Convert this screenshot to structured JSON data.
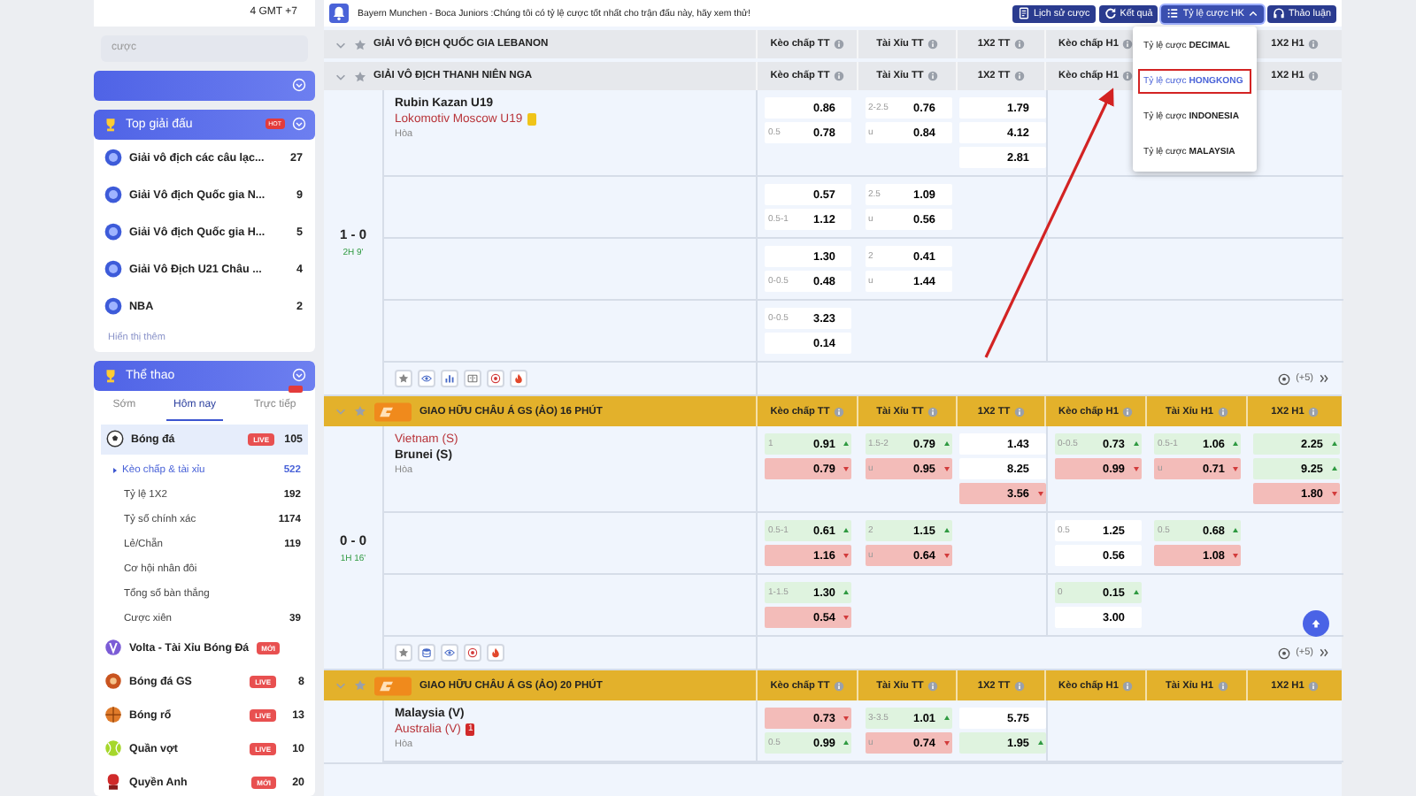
{
  "header": {
    "timezone": "4 GMT +7",
    "search": {
      "placeholder": "cược"
    }
  },
  "notice": {
    "text": "Bayern Munchen - Boca Juniors :Chúng tôi có tỷ lệ cược tốt nhất cho trận đấu này, hãy xem thử!"
  },
  "toolbar": {
    "history": {
      "label": "Lịch sử cược"
    },
    "results": {
      "label": "Kết quả"
    },
    "odds_format": {
      "label": "Tỷ lệ cược HK",
      "expanded": true,
      "items": [
        {
          "label": "Tỷ lệ cược **DECIMAL**",
          "selected": false
        },
        {
          "label": "Tỷ lệ cược **HONGKONG**",
          "selected": true
        },
        {
          "label": "Tỷ lệ cược **INDONESIA**",
          "selected": false
        },
        {
          "label": "Tỷ lệ cược **MALAYSIA**",
          "selected": false
        }
      ]
    },
    "discussion": {
      "label": "Thảo luận"
    }
  },
  "top_leagues": {
    "title": "Top giải đấu",
    "badge": "HOT",
    "items": [
      {
        "name": "Giải vô địch các câu lạc...",
        "count": "27"
      },
      {
        "name": "Giải Vô địch Quốc gia N...",
        "count": "9"
      },
      {
        "name": "Giải Vô địch Quốc gia H...",
        "count": "5"
      },
      {
        "name": "Giải Vô Địch U21 Châu ...",
        "count": "4"
      },
      {
        "name": "NBA",
        "count": "2"
      }
    ],
    "more": "Hiển thị thêm"
  },
  "sports": {
    "title": "Thể thao",
    "tabs": [
      {
        "label": "Sớm",
        "selected": false,
        "alert": false
      },
      {
        "label": "Hôm nay",
        "selected": true,
        "alert": false
      },
      {
        "label": "Trực tiếp",
        "selected": false,
        "alert": true
      }
    ],
    "items": [
      {
        "name": "Bóng đá",
        "badge": "LIVE",
        "count": "105",
        "selected": true,
        "children": [
          {
            "label": "Kèo chấp & tài xỉu",
            "count": "522",
            "selected": true
          },
          {
            "label": "Tỷ lệ 1X2",
            "count": "192",
            "selected": false
          },
          {
            "label": "Tỷ số chính xác",
            "count": "1174",
            "selected": false
          },
          {
            "label": "Lẻ/Chẵn",
            "count": "119",
            "selected": false
          },
          {
            "label": "Cơ hội nhân đôi",
            "selected": false
          },
          {
            "label": "Tổng số bàn thắng",
            "selected": false
          },
          {
            "label": "Cược xiên",
            "count": "39",
            "selected": false
          }
        ]
      },
      {
        "name": "Volta - Tài Xỉu Bóng Đá",
        "badge": "MỚI",
        "selected": false
      },
      {
        "name": "Bóng đá GS",
        "badge": "LIVE",
        "count": "8",
        "selected": false
      },
      {
        "name": "Bóng rổ",
        "badge": "LIVE",
        "count": "13",
        "selected": false
      },
      {
        "name": "Quần vợt",
        "badge": "LIVE",
        "count": "10",
        "selected": false
      },
      {
        "name": "Quyền Anh",
        "badge": "MỚI",
        "count": "20",
        "selected": false
      }
    ]
  },
  "leagues": [
    {
      "kind": "regular",
      "name": "GIẢI VÔ ĐỊCH QUỐC GIA LEBANON",
      "columns": [
        "Kèo chấp TT",
        "Tài Xỉu TT",
        "1X2 TT",
        "Kèo chấp H1",
        null,
        "1X2 H1"
      ]
    },
    {
      "kind": "regular",
      "name": "GIẢI VÔ ĐỊCH THANH NIÊN NGA",
      "columns": [
        "Kèo chấp TT",
        "Tài Xỉu TT",
        "1X2 TT",
        "Kèo chấp H1",
        null,
        "1X2 H1"
      ],
      "matches": [
        {
          "home": {
            "name": "Rubin Kazan U19",
            "favorite": false
          },
          "away": {
            "name": "Lokomotiv Moscow U19",
            "favorite": true,
            "card": {
              "kind": "yellow"
            }
          },
          "draw": "Hòa",
          "score": "1 - 0",
          "time": "2H 9'",
          "more": "(+5)",
          "lines": [
            {
              "handicap_ft": [
                {
                  "odds": "0.86",
                  "kind": "plain"
                },
                {
                  "line": "0.5",
                  "odds": "0.78",
                  "kind": "plain"
                }
              ],
              "total_ft": [
                {
                  "line": "2-2.5",
                  "odds": "0.76",
                  "kind": "plain"
                },
                {
                  "line": "u",
                  "odds": "0.84",
                  "kind": "plain"
                }
              ],
              "result_ft": [
                {
                  "odds": "1.79",
                  "kind": "plain"
                },
                {
                  "odds": "4.12",
                  "kind": "plain"
                },
                {
                  "odds": "2.81",
                  "kind": "plain"
                }
              ]
            },
            {
              "handicap_ft": [
                {
                  "odds": "0.57",
                  "kind": "plain"
                },
                {
                  "line": "0.5-1",
                  "odds": "1.12",
                  "kind": "plain"
                }
              ],
              "total_ft": [
                {
                  "line": "2.5",
                  "odds": "1.09",
                  "kind": "plain"
                },
                {
                  "line": "u",
                  "odds": "0.56",
                  "kind": "plain"
                }
              ]
            },
            {
              "handicap_ft": [
                {
                  "odds": "1.30",
                  "kind": "plain"
                },
                {
                  "line": "0-0.5",
                  "odds": "0.48",
                  "kind": "plain"
                }
              ],
              "total_ft": [
                {
                  "line": "2",
                  "odds": "0.41",
                  "kind": "plain"
                },
                {
                  "line": "u",
                  "odds": "1.44",
                  "kind": "plain"
                }
              ]
            },
            {
              "handicap_ft": [
                {
                  "line": "0-0.5",
                  "odds": "3.23",
                  "kind": "plain"
                },
                {
                  "odds": "0.14",
                  "kind": "plain"
                }
              ]
            }
          ]
        }
      ]
    },
    {
      "kind": "virtual",
      "name": "GIAO HỮU CHÂU Á GS (ẢO) 16 PHÚT",
      "columns": [
        "Kèo chấp TT",
        "Tài Xỉu TT",
        "1X2 TT",
        "Kèo chấp H1",
        "Tài Xỉu H1",
        "1X2 H1"
      ],
      "matches": [
        {
          "home": {
            "name": "Vietnam (S)",
            "favorite": true
          },
          "away": {
            "name": "Brunei (S)",
            "favorite": false
          },
          "draw": "Hòa",
          "score": "0 - 0",
          "time": "1H 16'",
          "more": "(+5)",
          "lines": [
            {
              "handicap_ft": [
                {
                  "line": "1",
                  "odds": "0.91",
                  "kind": "up"
                },
                {
                  "odds": "0.79",
                  "kind": "down"
                }
              ],
              "total_ft": [
                {
                  "line": "1.5-2",
                  "odds": "0.79",
                  "kind": "up"
                },
                {
                  "line": "u",
                  "odds": "0.95",
                  "kind": "down"
                }
              ],
              "result_ft": [
                {
                  "odds": "1.43",
                  "kind": "plain"
                },
                {
                  "odds": "8.25",
                  "kind": "plain"
                },
                {
                  "odds": "3.56",
                  "kind": "down"
                }
              ],
              "handicap_h1": [
                {
                  "line": "0-0.5",
                  "odds": "0.73",
                  "kind": "up"
                },
                {
                  "odds": "0.99",
                  "kind": "down"
                }
              ],
              "total_h1": [
                {
                  "line": "0.5-1",
                  "odds": "1.06",
                  "kind": "up"
                },
                {
                  "line": "u",
                  "odds": "0.71",
                  "kind": "down"
                }
              ],
              "result_h1": [
                {
                  "odds": "2.25",
                  "kind": "up"
                },
                {
                  "odds": "9.25",
                  "kind": "up"
                },
                {
                  "odds": "1.80",
                  "kind": "down"
                }
              ]
            },
            {
              "handicap_ft": [
                {
                  "line": "0.5-1",
                  "odds": "0.61",
                  "kind": "up"
                },
                {
                  "odds": "1.16",
                  "kind": "down"
                }
              ],
              "total_ft": [
                {
                  "line": "2",
                  "odds": "1.15",
                  "kind": "up"
                },
                {
                  "line": "u",
                  "odds": "0.64",
                  "kind": "down"
                }
              ],
              "handicap_h1": [
                {
                  "line": "0.5",
                  "odds": "1.25",
                  "kind": "plain"
                },
                {
                  "odds": "0.56",
                  "kind": "plain"
                }
              ],
              "total_h1": [
                {
                  "line": "0.5",
                  "odds": "0.68",
                  "kind": "up"
                },
                {
                  "odds": "1.08",
                  "kind": "down"
                }
              ]
            },
            {
              "handicap_ft": [
                {
                  "line": "1-1.5",
                  "odds": "1.30",
                  "kind": "up"
                },
                {
                  "odds": "0.54",
                  "kind": "down"
                }
              ],
              "handicap_h1": [
                {
                  "line": "0",
                  "odds": "0.15",
                  "kind": "up"
                },
                {
                  "odds": "3.00",
                  "kind": "plain"
                }
              ]
            }
          ]
        }
      ]
    },
    {
      "kind": "virtual",
      "name": "GIAO HỮU CHÂU Á GS (ẢO) 20 PHÚT",
      "columns": [
        "Kèo chấp TT",
        "Tài Xỉu TT",
        "1X2 TT",
        "Kèo chấp H1",
        "Tài Xỉu H1",
        "1X2 H1"
      ],
      "matches": [
        {
          "home": {
            "name": "Malaysia (V)",
            "favorite": false
          },
          "away": {
            "name": "Australia (V)",
            "favorite": true,
            "card": {
              "kind": "red",
              "text": "1"
            }
          },
          "draw": "Hòa",
          "lines": [
            {
              "handicap_ft": [
                {
                  "odds": "0.73",
                  "kind": "down"
                },
                {
                  "line": "0.5",
                  "odds": "0.99",
                  "kind": "up"
                }
              ],
              "total_ft": [
                {
                  "line": "3-3.5",
                  "odds": "1.01",
                  "kind": "up"
                },
                {
                  "line": "u",
                  "odds": "0.74",
                  "kind": "down"
                }
              ],
              "result_ft": [
                {
                  "odds": "5.75",
                  "kind": "plain"
                },
                {
                  "odds": "1.95",
                  "kind": "up"
                }
              ]
            }
          ]
        }
      ]
    }
  ]
}
